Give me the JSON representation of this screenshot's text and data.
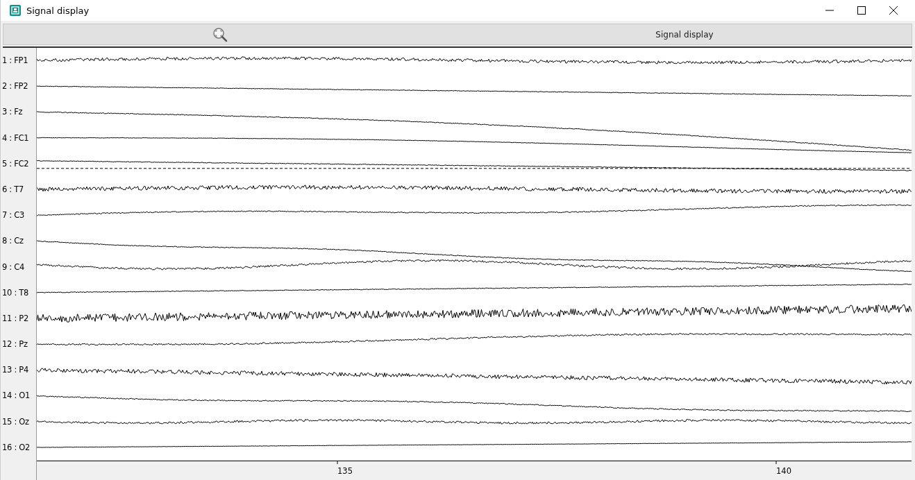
{
  "window": {
    "title": "Signal display"
  },
  "toolbar": {
    "title": "Signal display"
  },
  "channels": [
    "1 : FP1",
    "2 : FP2",
    "3 : Fz",
    "4 : FC1",
    "5 : FC2",
    "6 : T7",
    "7 : C3",
    "8 : Cz",
    "9 : C4",
    "10 : T8",
    "11 : P2",
    "12 : Pz",
    "13 : P4",
    "14 : O1",
    "15 : Oz",
    "16 : O2"
  ],
  "x_axis": {
    "ticks": [
      "135",
      "140"
    ]
  }
}
